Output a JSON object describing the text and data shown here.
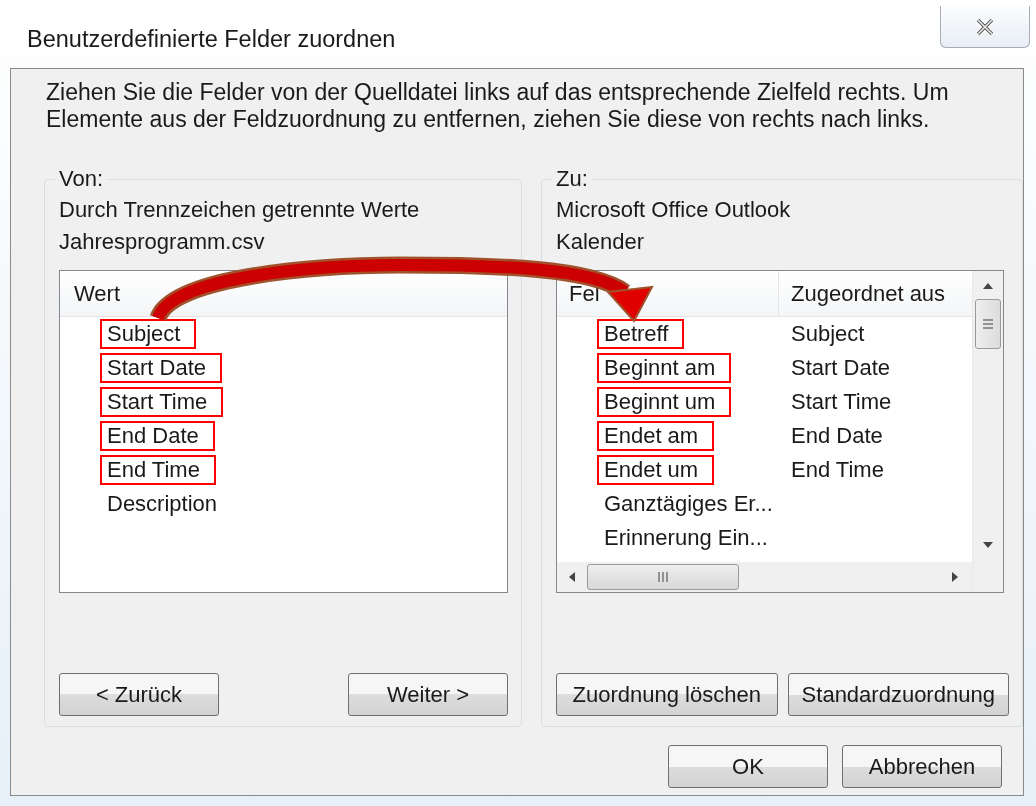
{
  "window": {
    "title": "Benutzerdefinierte Felder zuordnen"
  },
  "instruction": "Ziehen Sie die Felder von der Quelldatei links auf das entsprechende Zielfeld rechts. Um Elemente aus der Feldzuordnung zu entfernen, ziehen Sie diese von rechts nach links.",
  "source": {
    "legend": "Von:",
    "type": "Durch Trennzeichen getrennte Werte",
    "file": "Jahresprogramm.csv",
    "column": "Wert",
    "items": [
      {
        "text": "Subject",
        "highlighted": true
      },
      {
        "text": "Start Date",
        "highlighted": true
      },
      {
        "text": "Start Time",
        "highlighted": true
      },
      {
        "text": "End Date",
        "highlighted": true
      },
      {
        "text": "End Time",
        "highlighted": true
      },
      {
        "text": "Description",
        "highlighted": false
      }
    ],
    "buttons": [
      "< Zurück",
      "Weiter >"
    ]
  },
  "target": {
    "legend": "Zu:",
    "type": "Microsoft Office Outlook",
    "file": "Kalender",
    "columns": [
      "Fel",
      "Zugeordnet aus"
    ],
    "rows": [
      {
        "field": "Betreff",
        "mapped_from": "Subject",
        "highlighted": true
      },
      {
        "field": "Beginnt am",
        "mapped_from": "Start Date",
        "highlighted": true
      },
      {
        "field": "Beginnt um",
        "mapped_from": "Start Time",
        "highlighted": true
      },
      {
        "field": "Endet am",
        "mapped_from": "End Date",
        "highlighted": true
      },
      {
        "field": "Endet um",
        "mapped_from": "End Time",
        "highlighted": true
      },
      {
        "field": "Ganztägiges Er...",
        "highlighted": false
      },
      {
        "field": "Erinnerung Ein...",
        "highlighted": false
      }
    ],
    "buttons": [
      "Zuordnung löschen",
      "Standardzuordnung"
    ]
  },
  "buttons": [
    "OK",
    "Abbrechen"
  ]
}
